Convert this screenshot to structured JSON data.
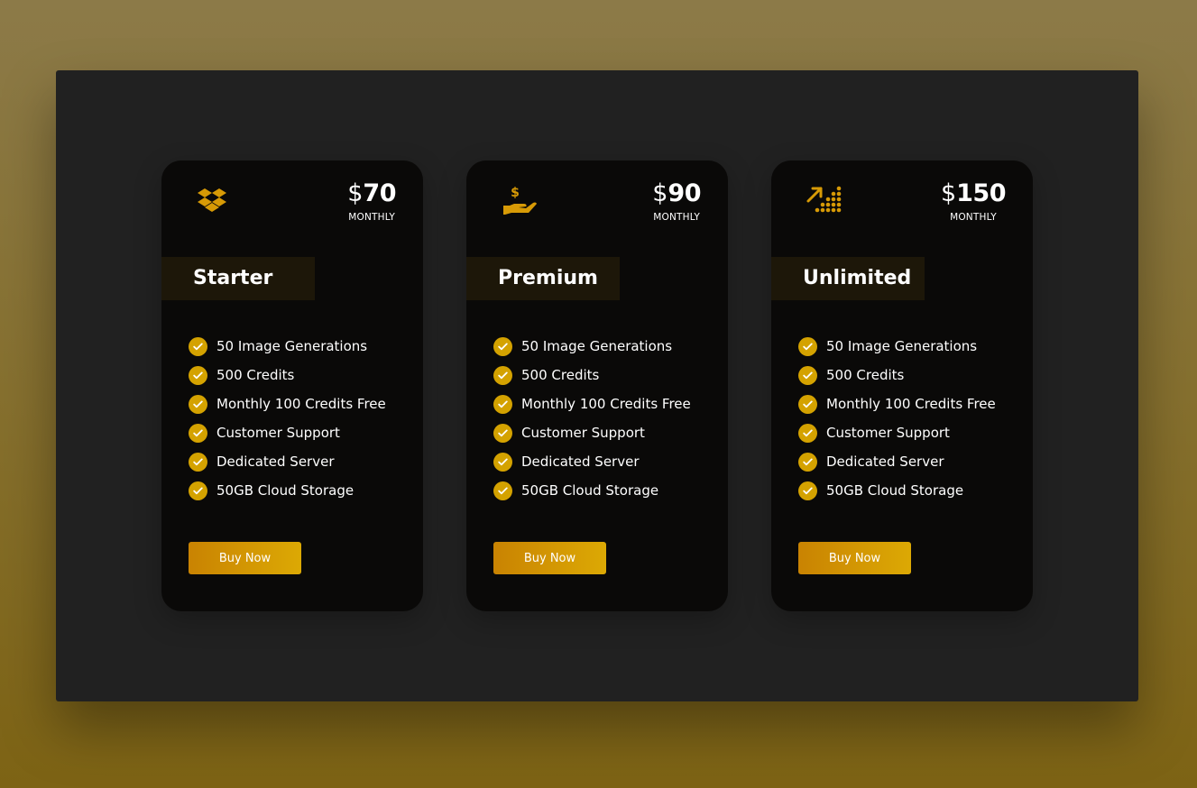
{
  "plans": [
    {
      "icon": "dropbox-icon",
      "currency": "$",
      "price": "70",
      "period": "MONTHLY",
      "name": "Starter",
      "features": [
        "50 Image Generations",
        "500 Credits",
        "Monthly 100 Credits Free",
        "Customer Support",
        "Dedicated Server",
        "50GB Cloud Storage"
      ],
      "button_label": "Buy Now"
    },
    {
      "icon": "hand-dollar-icon",
      "currency": "$",
      "price": "90",
      "period": "MONTHLY",
      "name": "Premium",
      "features": [
        "50 Image Generations",
        "500 Credits",
        "Monthly 100 Credits Free",
        "Customer Support",
        "Dedicated Server",
        "50GB Cloud Storage"
      ],
      "button_label": "Buy Now"
    },
    {
      "icon": "growth-chart-icon",
      "currency": "$",
      "price": "150",
      "period": "MONTHLY",
      "name": "Unlimited",
      "features": [
        "50 Image Generations",
        "500 Credits",
        "Monthly 100 Credits Free",
        "Customer Support",
        "Dedicated Server",
        "50GB Cloud Storage"
      ],
      "button_label": "Buy Now"
    }
  ],
  "colors": {
    "accent": "#d4a200",
    "card_background": "#0a0908",
    "panel_background": "#212121"
  }
}
